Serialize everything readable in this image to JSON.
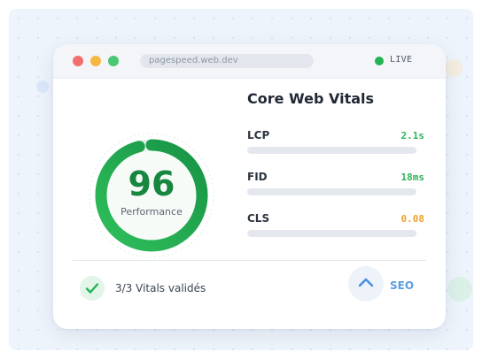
{
  "window": {
    "url": "pagespeed.web.dev",
    "status_label": "LIVE",
    "status_color": "#22b455"
  },
  "score": {
    "value": 96,
    "label": "Performance",
    "fraction": 0.96,
    "color": "#17873f"
  },
  "vitals": {
    "title": "Core Web Vitals",
    "metrics": [
      {
        "name": "LCP",
        "value": "2.1s",
        "status": "good",
        "color": "#2fb35a"
      },
      {
        "name": "FID",
        "value": "18ms",
        "status": "good",
        "color": "#2fb35a"
      },
      {
        "name": "CLS",
        "value": "0.08",
        "status": "needs-improvement",
        "color": "#f0a12b"
      }
    ]
  },
  "footer": {
    "check_icon": "check-icon",
    "status_text": "3/3 Vitals validés",
    "seo_icon": "chevron-up-icon",
    "seo_label": "SEO"
  }
}
